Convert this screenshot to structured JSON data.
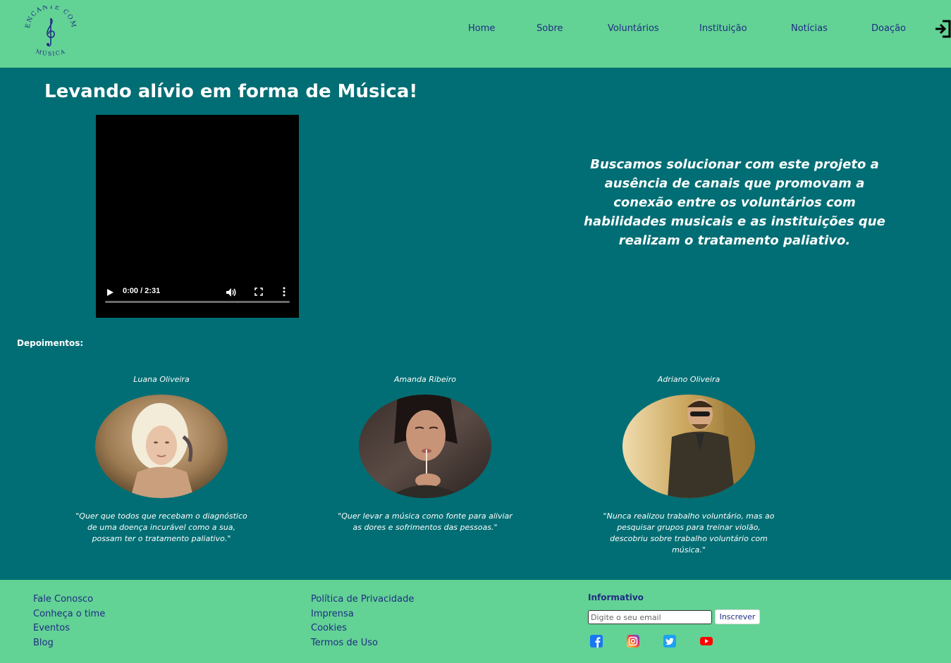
{
  "header": {
    "logo": {
      "top_text": "ENCANTE COM",
      "bottom_text": "MÚSICA",
      "icon": "treble-clef-icon"
    },
    "nav": [
      {
        "label": "Home"
      },
      {
        "label": "Sobre"
      },
      {
        "label": "Voluntários"
      },
      {
        "label": "Instituição"
      },
      {
        "label": "Notícias"
      },
      {
        "label": "Doação"
      }
    ],
    "exit_icon": "exit-icon"
  },
  "main": {
    "headline": "Levando alívio em forma de Música!",
    "video": {
      "time": "0:00 / 2:31",
      "progress": 0
    },
    "mission": "Buscamos solucionar com este projeto a ausência de canais que promovam a conexão entre os voluntários com habilidades musicais e as instituições que realizam o tratamento paliativo."
  },
  "testimonials": {
    "heading": "Depoimentos:",
    "items": [
      {
        "name": "Luana Oliveira",
        "quote": "\"Quer que todos que recebam o diagnóstico de uma doença incurável como a sua, possam ter o tratamento paliativo.\""
      },
      {
        "name": "Amanda Ribeiro",
        "quote": "\"Quer levar a música como fonte para aliviar as dores e sofrimentos das pessoas.\""
      },
      {
        "name": "Adriano Oliveira",
        "quote": "\"Nunca realizou trabalho voluntário, mas ao pesquisar grupos para treinar violão, descobriu sobre trabalho voluntário com música.\""
      }
    ]
  },
  "footer": {
    "col1": [
      {
        "label": "Fale Conosco"
      },
      {
        "label": "Conheça o time"
      },
      {
        "label": "Eventos"
      },
      {
        "label": "Blog"
      }
    ],
    "col2": [
      {
        "label": "Política de Privacidade"
      },
      {
        "label": "Imprensa"
      },
      {
        "label": "Cookies"
      },
      {
        "label": "Termos de Uso"
      }
    ],
    "newsletter": {
      "title": "Informativo",
      "placeholder": "Digite o seu email",
      "button": "Inscrever"
    },
    "social": [
      "facebook-icon",
      "instagram-icon",
      "twitter-icon",
      "youtube-icon"
    ]
  },
  "colors": {
    "header_bg": "#63d295",
    "main_bg": "#006e74",
    "link": "#1e2e83",
    "text_light": "#ffffff"
  }
}
